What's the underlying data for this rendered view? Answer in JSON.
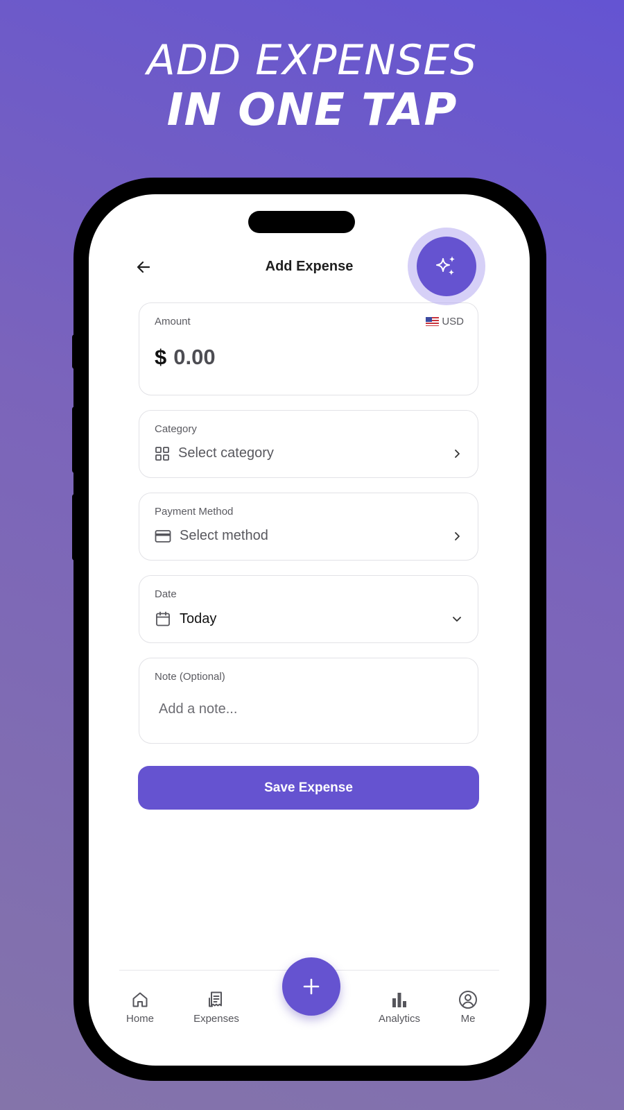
{
  "headline": {
    "line1": "ADD EXPENSES",
    "line2": "IN ONE TAP"
  },
  "header": {
    "title": "Add Expense"
  },
  "amount": {
    "label": "Amount",
    "currency_code": "USD",
    "currency_symbol": "$",
    "value": "0.00"
  },
  "category": {
    "label": "Category",
    "value": "Select category"
  },
  "payment": {
    "label": "Payment Method",
    "value": "Select method"
  },
  "date": {
    "label": "Date",
    "value": "Today"
  },
  "note": {
    "label": "Note (Optional)",
    "placeholder": "Add a note..."
  },
  "actions": {
    "save_label": "Save Expense"
  },
  "tabbar": {
    "home": "Home",
    "expenses": "Expenses",
    "analytics": "Analytics",
    "me": "Me"
  },
  "colors": {
    "accent": "#6553d0",
    "text": "#1f1f1f",
    "muted": "#58585e",
    "border": "#e2e2e6"
  },
  "icons": [
    "back-arrow-icon",
    "sparkles-icon",
    "us-flag-icon",
    "grid-icon",
    "credit-card-icon",
    "calendar-icon",
    "chevron-right-icon",
    "chevron-down-icon",
    "home-icon",
    "receipt-icon",
    "plus-icon",
    "bar-chart-icon",
    "user-circle-icon"
  ]
}
